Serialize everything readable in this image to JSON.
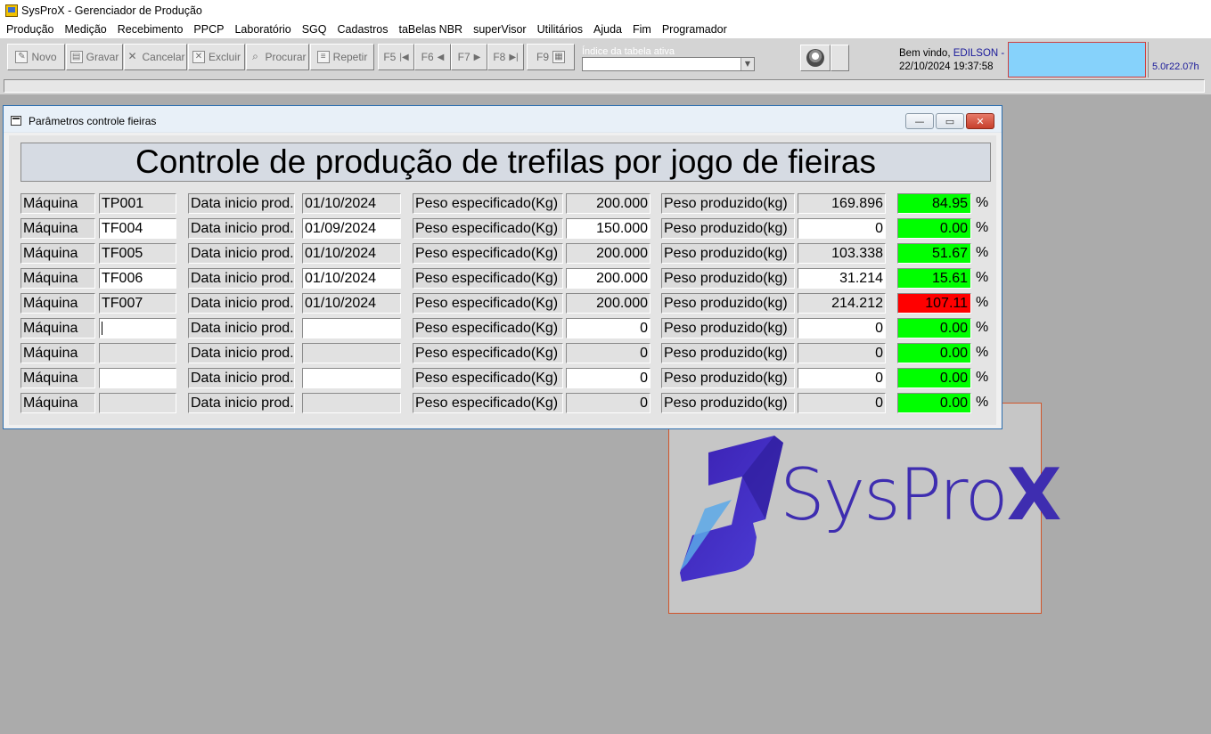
{
  "window_title": "SysProX - Gerenciador de Produção",
  "menu": [
    "Produção",
    "Medição",
    "Recebimento",
    "PPCP",
    "Laboratório",
    "SGQ",
    "Cadastros",
    "taBelas NBR",
    "superVisor",
    "Utilitários",
    "Ajuda",
    "Fim",
    "Programador"
  ],
  "toolbar": {
    "novo": "Novo",
    "gravar": "Gravar",
    "cancelar": "Cancelar",
    "excluir": "Excluir",
    "procurar": "Procurar",
    "repetir": "Repetir",
    "f5": "F5",
    "f6": "F6",
    "f7": "F7",
    "f8": "F8",
    "f9": "F9",
    "index_label": "Índice da tabela ativa",
    "index_value": "",
    "welcome": "Bem vindo,",
    "user": "EDILSON -",
    "datetime": "22/10/2024  19:37:58",
    "version": "5.0r22.07h"
  },
  "logo": {
    "text_main": "SysPro",
    "text_x": "X",
    "colors": {
      "primary": "#3e2db0",
      "accent": "#5aa8e8"
    }
  },
  "child_window": {
    "title": "Parâmetros controle fieiras",
    "heading": "Controle de produção de trefilas por jogo de fieiras",
    "labels": {
      "maquina": "Máquina",
      "data_inicio": "Data inicio prod.",
      "peso_especificado": "Peso especificado(Kg)",
      "peso_produzido": "Peso produzido(kg)",
      "pct": "%"
    },
    "rows": [
      {
        "maquina": "TP001",
        "data": "01/10/2024",
        "peso_esp": "200.000",
        "peso_prod": "169.896",
        "pct": "84.95",
        "status": "ok",
        "editable": false
      },
      {
        "maquina": "TF004",
        "data": "01/09/2024",
        "peso_esp": "150.000",
        "peso_prod": "0",
        "pct": "0.00",
        "status": "ok",
        "editable": true
      },
      {
        "maquina": "TF005",
        "data": "01/10/2024",
        "peso_esp": "200.000",
        "peso_prod": "103.338",
        "pct": "51.67",
        "status": "ok",
        "editable": false
      },
      {
        "maquina": "TF006",
        "data": "01/10/2024",
        "peso_esp": "200.000",
        "peso_prod": "31.214",
        "pct": "15.61",
        "status": "ok",
        "editable": true
      },
      {
        "maquina": "TF007",
        "data": "01/10/2024",
        "peso_esp": "200.000",
        "peso_prod": "214.212",
        "pct": "107.11",
        "status": "over",
        "editable": false
      },
      {
        "maquina": "",
        "data": "",
        "peso_esp": "0",
        "peso_prod": "0",
        "pct": "0.00",
        "status": "ok",
        "editable": true,
        "focused": true
      },
      {
        "maquina": "",
        "data": "",
        "peso_esp": "0",
        "peso_prod": "0",
        "pct": "0.00",
        "status": "ok",
        "editable": false
      },
      {
        "maquina": "",
        "data": "",
        "peso_esp": "0",
        "peso_prod": "0",
        "pct": "0.00",
        "status": "ok",
        "editable": true
      },
      {
        "maquina": "",
        "data": "",
        "peso_esp": "0",
        "peso_prod": "0",
        "pct": "0.00",
        "status": "ok",
        "editable": false
      }
    ],
    "status_colors": {
      "ok": "#00ff00",
      "over": "#ff0000"
    }
  }
}
